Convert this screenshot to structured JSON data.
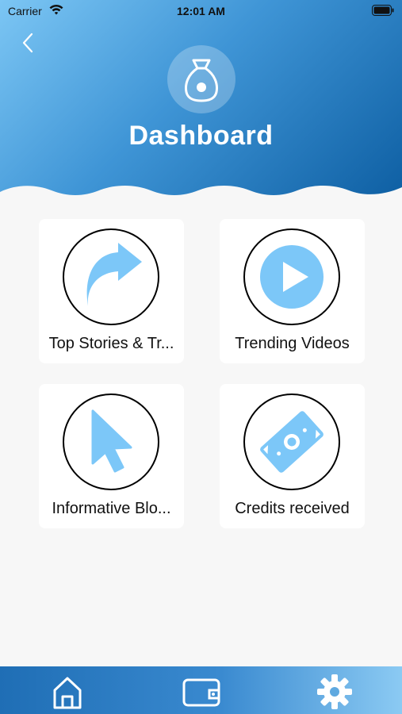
{
  "status_bar": {
    "carrier": "Carrier",
    "time": "12:01 AM"
  },
  "header": {
    "title": "Dashboard",
    "logo_icon": "money-bag-icon",
    "back_icon": "chevron-left-icon"
  },
  "cards": [
    {
      "label": "Top Stories & Tr...",
      "icon": "share-arrow-icon"
    },
    {
      "label": "Trending Videos",
      "icon": "play-icon"
    },
    {
      "label": "Informative Blo...",
      "icon": "cursor-pointer-icon"
    },
    {
      "label": "Credits received",
      "icon": "money-bill-icon"
    }
  ],
  "tabbar": {
    "items": [
      {
        "icon": "home-icon"
      },
      {
        "icon": "wallet-icon"
      },
      {
        "icon": "gear-icon"
      }
    ]
  },
  "colors": {
    "header_gradient_start": "#7cc6f4",
    "header_gradient_end": "#0e5fa3",
    "icon_fill": "#7cc7f8",
    "background": "#f7f7f7"
  }
}
